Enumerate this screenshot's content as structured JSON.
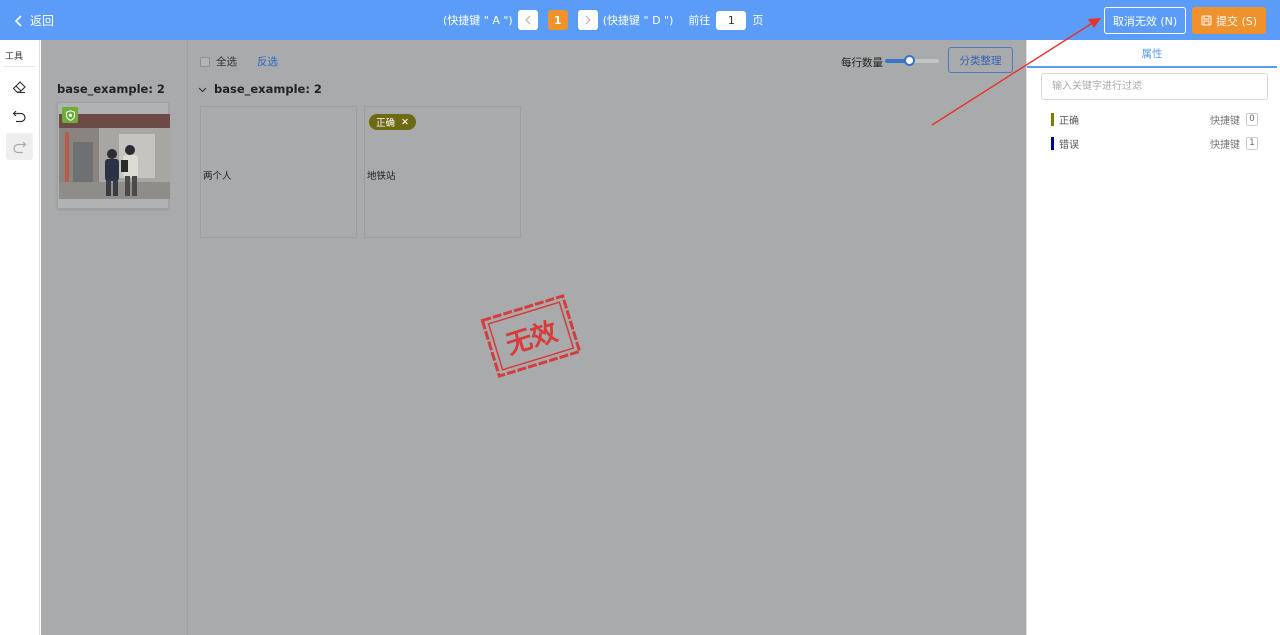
{
  "header": {
    "back_label": "返回",
    "prev_hint": "(快捷键 \" A \")",
    "next_hint": "(快捷键 \" D \")",
    "current_page": "1",
    "goto_label": "前往",
    "goto_value": "1",
    "page_unit": "页",
    "cancel_invalid_label": "取消无效 (N)",
    "submit_label": "提交 (S)"
  },
  "toolbar": {
    "title": "工具",
    "tools": [
      "eraser-icon",
      "undo-icon",
      "redo-icon"
    ]
  },
  "workspace": {
    "thumb_group_title": "base_example: 2",
    "select_all_label": "全选",
    "invert_label": "反选",
    "per_row_label": "每行数量",
    "per_row_level": 0.45,
    "sort_button_label": "分类整理",
    "group_title": "base_example: 2",
    "cards": [
      {
        "label": "两个人",
        "tags": []
      },
      {
        "label": "地铁站",
        "tags": [
          "正确"
        ]
      }
    ],
    "stamp_text": "无效"
  },
  "panel": {
    "tab_label": "属性",
    "search_placeholder": "输入关键字进行过滤",
    "attributes": [
      {
        "name": "正确",
        "shortcut_label": "快捷键",
        "key": "0",
        "color": "#7a7a00"
      },
      {
        "name": "错误",
        "shortcut_label": "快捷键",
        "key": "1",
        "color": "#00008b"
      }
    ]
  },
  "colors": {
    "header": "#5a9cf8",
    "accent_orange": "#f0922c",
    "tag": "#6e6a14",
    "stamp": "#d63c3c",
    "overlay": "#a9aaab"
  }
}
